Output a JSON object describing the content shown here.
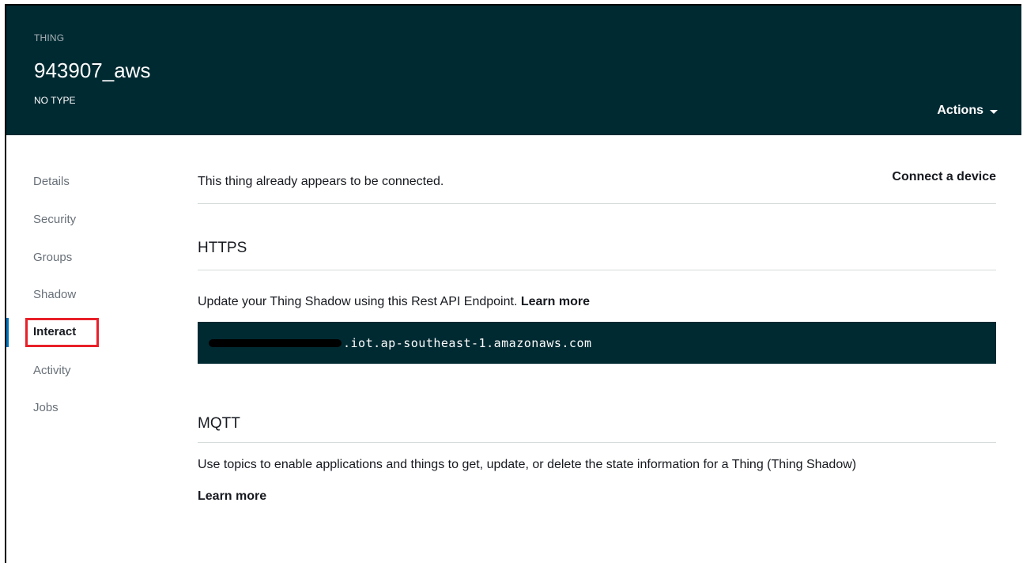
{
  "header": {
    "kind_label": "THING",
    "title": "943907_aws",
    "type_label": "NO TYPE",
    "actions_label": "Actions"
  },
  "sidebar": {
    "items": [
      {
        "label": "Details"
      },
      {
        "label": "Security"
      },
      {
        "label": "Groups"
      },
      {
        "label": "Shadow"
      },
      {
        "label": "Interact"
      },
      {
        "label": "Activity"
      },
      {
        "label": "Jobs"
      }
    ],
    "active_index": 4
  },
  "main": {
    "connected_text": "This thing already appears to be connected.",
    "connect_link": "Connect a device",
    "https": {
      "title": "HTTPS",
      "description": "Update your Thing Shadow using this Rest API Endpoint.",
      "learn_more": "Learn more",
      "endpoint_visible": ".iot.ap-southeast-1.amazonaws.com"
    },
    "mqtt": {
      "title": "MQTT",
      "description": "Use topics to enable applications and things to get, update, or delete the state information for a Thing (Thing Shadow)",
      "learn_more": "Learn more"
    }
  },
  "colors": {
    "header_bg": "#002a32",
    "highlight_box": "#e8202a",
    "active_indicator": "#0073bb"
  }
}
